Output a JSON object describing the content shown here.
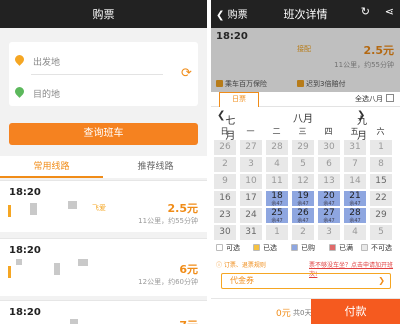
{
  "colors": {
    "accent": "#f08c18",
    "selected": "#8ea6e0",
    "pay": "#f55a1f",
    "dark": "#222222"
  },
  "left": {
    "title": "购票",
    "from_placeholder": "出发地",
    "to_placeholder": "目的地",
    "query_button": "查询班车",
    "tabs": [
      "常用线路",
      "推荐线路"
    ],
    "routes": [
      {
        "time": "18:20",
        "tag": "飞爱",
        "price": "2.5元",
        "meta": "11公里，约55分钟"
      },
      {
        "time": "18:20",
        "tag": "",
        "price": "6元",
        "meta": "12公里，约60分钟"
      },
      {
        "time": "18:20",
        "tag": "",
        "price": "7元",
        "meta": ""
      }
    ]
  },
  "right": {
    "back_label": "购票",
    "title": "班次详情",
    "summary": {
      "time": "18:20",
      "tag": "接配",
      "price": "2.5元",
      "meta": "11公里，约55分钟",
      "insurance": "乘车百万保险",
      "delay": "迟到3倍赔付"
    },
    "calendar": {
      "tab": "日票",
      "select_all": "全选八月",
      "months": [
        "七月",
        "八月",
        "九月"
      ],
      "weekdays": [
        "日",
        "一",
        "二",
        "三",
        "四",
        "五",
        "六"
      ],
      "weeks": [
        [
          {
            "d": "26",
            "m": 1
          },
          {
            "d": "27",
            "m": 1
          },
          {
            "d": "28",
            "m": 1
          },
          {
            "d": "29",
            "m": 1
          },
          {
            "d": "30",
            "m": 1
          },
          {
            "d": "31",
            "m": 1
          },
          {
            "d": "1",
            "m": 1
          }
        ],
        [
          {
            "d": "2",
            "m": 1
          },
          {
            "d": "3",
            "m": 1
          },
          {
            "d": "4",
            "m": 1
          },
          {
            "d": "5",
            "m": 1
          },
          {
            "d": "6",
            "m": 1
          },
          {
            "d": "7",
            "m": 1
          },
          {
            "d": "8",
            "m": 1
          }
        ],
        [
          {
            "d": "9",
            "m": 1
          },
          {
            "d": "10",
            "m": 1
          },
          {
            "d": "11",
            "m": 1
          },
          {
            "d": "12",
            "m": 1
          },
          {
            "d": "13",
            "m": 1
          },
          {
            "d": "14",
            "m": 1
          },
          {
            "d": "15",
            "m": 0
          }
        ],
        [
          {
            "d": "16",
            "m": 0
          },
          {
            "d": "17",
            "m": 0
          },
          {
            "d": "18",
            "s": 1,
            "sub": "余47"
          },
          {
            "d": "19",
            "s": 1,
            "sub": "余47"
          },
          {
            "d": "20",
            "s": 1,
            "sub": "余47"
          },
          {
            "d": "21",
            "s": 1,
            "sub": "余47"
          },
          {
            "d": "22",
            "m": 0
          }
        ],
        [
          {
            "d": "23",
            "m": 0
          },
          {
            "d": "24",
            "m": 0
          },
          {
            "d": "25",
            "s": 1,
            "sub": "余47"
          },
          {
            "d": "26",
            "s": 1,
            "sub": "余47"
          },
          {
            "d": "27",
            "s": 1,
            "sub": "余47"
          },
          {
            "d": "28",
            "s": 1,
            "sub": "余47"
          },
          {
            "d": "29",
            "m": 0
          }
        ],
        [
          {
            "d": "30",
            "m": 0
          },
          {
            "d": "31",
            "m": 0
          },
          {
            "d": "1",
            "m": 1
          },
          {
            "d": "2",
            "m": 1
          },
          {
            "d": "3",
            "m": 1
          },
          {
            "d": "4",
            "m": 1
          },
          {
            "d": "5",
            "m": 1
          }
        ]
      ]
    },
    "legend": [
      {
        "label": "可选",
        "color": "#ffffff"
      },
      {
        "label": "已选",
        "color": "#f5c242"
      },
      {
        "label": "已购",
        "color": "#8ea6e0"
      },
      {
        "label": "已满",
        "color": "#e06a6a"
      },
      {
        "label": "不可选",
        "color": "#e8e8e8"
      }
    ],
    "notice": "订票、退票规则",
    "notice2": "票不够没车坐？点击申请加开班次!",
    "coupon": "代金券",
    "pay": {
      "amount": "0元",
      "days": "共0天",
      "button": "付款"
    }
  }
}
